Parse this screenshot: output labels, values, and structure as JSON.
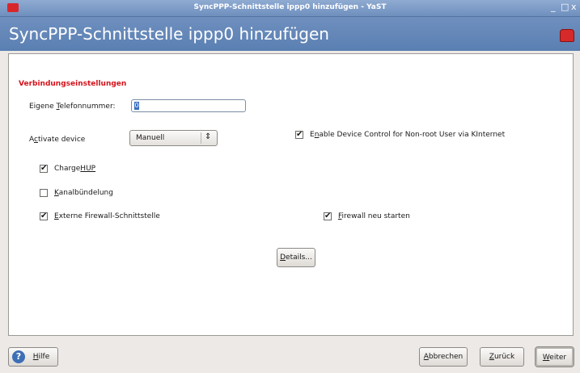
{
  "window": {
    "title": "SyncPPP-Schnittstelle ippp0 hinzufügen - YaST",
    "minimize": "_",
    "maximize": "□",
    "close": "x"
  },
  "header": {
    "title": "SyncPPP-Schnittstelle ippp0 hinzufügen"
  },
  "form": {
    "section": "Verbindungseinstellungen",
    "phone": {
      "label_pre": "Eigene ",
      "label_key": "T",
      "label_post": "elefonnummer:",
      "value": "0"
    },
    "activate": {
      "label_pre": "A",
      "label_key": "c",
      "label_post": "tivate device",
      "value": "Manuell"
    },
    "enable_control": {
      "checked": true,
      "label_pre": "E",
      "label_key": "n",
      "label_post": "able Device Control for Non-root User via KInternet"
    },
    "chargehup": {
      "checked": true,
      "label_pre": "Charge",
      "label_key": "HUP",
      "label_post": ""
    },
    "kanal": {
      "checked": false,
      "label_pre": "",
      "label_key": "K",
      "label_post": "analbündelung"
    },
    "external_fw": {
      "checked": true,
      "label_pre": "",
      "label_key": "E",
      "label_post": "xterne Firewall-Schnittstelle"
    },
    "fw_restart": {
      "checked": true,
      "label_pre": "",
      "label_key": "F",
      "label_post": "irewall neu starten"
    },
    "details_button": {
      "key": "D",
      "rest": "etails..."
    }
  },
  "footer": {
    "help": {
      "key": "H",
      "rest": "ilfe"
    },
    "abort": {
      "key": "A",
      "rest": "bbrechen"
    },
    "back": {
      "key": "Z",
      "rest": "urück"
    },
    "next": {
      "key": "W",
      "rest": "eiter"
    }
  },
  "check_glyph": "✔",
  "colors": {
    "section_title": "#d4121b",
    "header_bg": "#5a7fb2"
  }
}
